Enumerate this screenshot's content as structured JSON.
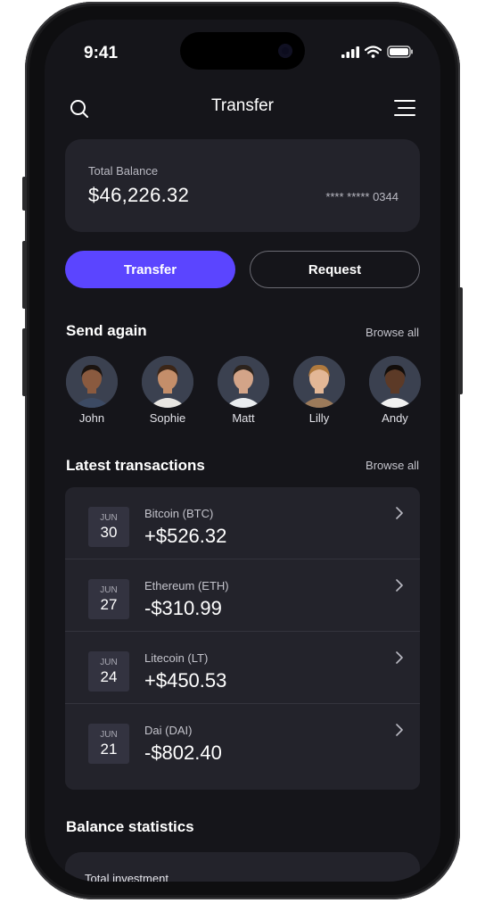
{
  "status": {
    "time": "9:41"
  },
  "header": {
    "title": "Transfer"
  },
  "balance": {
    "label": "Total Balance",
    "amount": "$46,226.32",
    "card_number": "****  *****  0344"
  },
  "actions": {
    "transfer": "Transfer",
    "request": "Request"
  },
  "send_again": {
    "title": "Send again",
    "browse": "Browse all",
    "contacts": [
      {
        "name": "John",
        "skin": "#8a5a3f",
        "hair": "#1b1410",
        "shirt": "#3c4a63"
      },
      {
        "name": "Sophie",
        "skin": "#c48e6a",
        "hair": "#3b2618",
        "shirt": "#e8e6e2"
      },
      {
        "name": "Matt",
        "skin": "#d3a488",
        "hair": "#2c231d",
        "shirt": "#e9ecef"
      },
      {
        "name": "Lilly",
        "skin": "#e3b796",
        "hair": "#b07a3e",
        "shirt": "#9c7a5a"
      },
      {
        "name": "Andy",
        "skin": "#5c3a27",
        "hair": "#120d0a",
        "shirt": "#f1f1f1"
      }
    ]
  },
  "transactions": {
    "title": "Latest transactions",
    "browse": "Browse all",
    "items": [
      {
        "month": "JUN",
        "day": "30",
        "coin": "Bitcoin (BTC)",
        "value": "+$526.32"
      },
      {
        "month": "JUN",
        "day": "27",
        "coin": "Ethereum (ETH)",
        "value": "-$310.99"
      },
      {
        "month": "JUN",
        "day": "24",
        "coin": "Litecoin (LT)",
        "value": "+$450.53"
      },
      {
        "month": "JUN",
        "day": "21",
        "coin": "Dai (DAI)",
        "value": "-$802.40"
      }
    ]
  },
  "statistics": {
    "title": "Balance statistics",
    "total_label": "Total investment"
  },
  "colors": {
    "accent": "#5b45ff",
    "background": "#15151a",
    "card": "#23232b"
  }
}
